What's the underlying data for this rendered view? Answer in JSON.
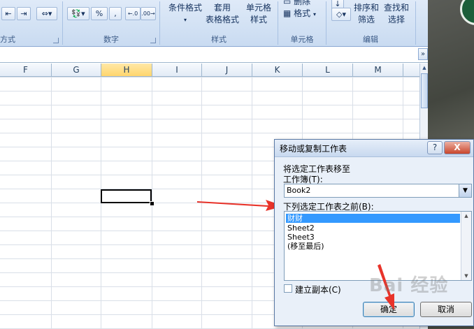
{
  "ribbon": {
    "groups": [
      {
        "label": "方式"
      },
      {
        "label": "数字"
      },
      {
        "label": "样式"
      },
      {
        "label": "单元格"
      },
      {
        "label": "编辑"
      }
    ],
    "number": {
      "percent": "%",
      "comma": ",",
      "inc_decimal": ".0 .00",
      "dec_decimal": ".00 .0"
    },
    "styles": {
      "conditional": "条件格式",
      "table_format_1": "套用",
      "table_format_2": "表格格式",
      "cell_style_1": "单元格",
      "cell_style_2": "样式"
    },
    "cells": {
      "delete": "删除",
      "format": "格式"
    },
    "editing": {
      "sort_1": "排序和",
      "sort_2": "筛选",
      "find_1": "查找和",
      "find_2": "选择"
    }
  },
  "formula_bar": {
    "expand": "»"
  },
  "columns": [
    "F",
    "G",
    "H",
    "I",
    "J",
    "K",
    "L",
    "M"
  ],
  "selected_column": "H",
  "dialog": {
    "title": "移动或复制工作表",
    "help": "?",
    "close": "X",
    "move_to_label": "将选定工作表移至",
    "workbook_label": "工作簿(T):",
    "workbook_value": "Book2",
    "before_label": "下列选定工作表之前(B):",
    "sheets": [
      "财财",
      "Sheet2",
      "Sheet3",
      "(移至最后)"
    ],
    "selected_sheet": "财财",
    "copy_label": "建立副本(C)",
    "copy_checked": false,
    "ok": "确定",
    "cancel": "取消"
  },
  "watermark": "Bai 经验",
  "colors": {
    "accent_red": "#e8332a",
    "selection_blue": "#3399ff"
  }
}
